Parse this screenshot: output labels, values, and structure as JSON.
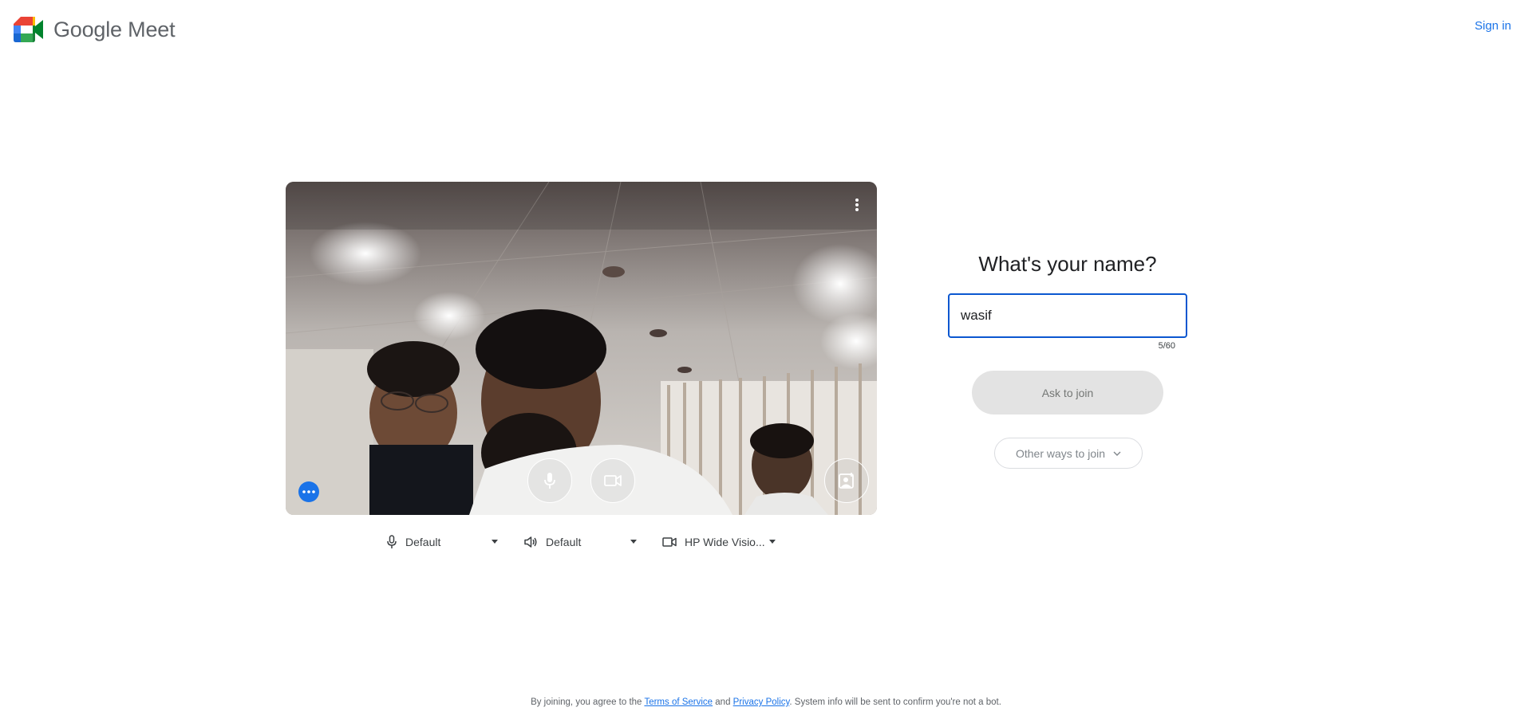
{
  "header": {
    "brand": "Google Meet",
    "sign_in_label": "Sign in"
  },
  "devices": {
    "microphone": "Default",
    "speaker": "Default",
    "camera": "HP Wide Visio..."
  },
  "join": {
    "title": "What's your name?",
    "name_value": "wasif",
    "char_counter": "5/60",
    "ask_button": "Ask to join",
    "other_ways_button": "Other ways to join"
  },
  "footer": {
    "prefix": "By joining, you agree to the",
    "terms_link": "Terms of Service",
    "and_text": "and",
    "privacy_link": "Privacy Policy",
    "suffix": ". System info will be sent to confirm you're not a bot."
  },
  "icons": {
    "logo": "google-meet-logo-icon",
    "more": "more-vert-icon",
    "mic": "microphone-icon",
    "camera": "video-camera-icon",
    "effects": "visual-effects-icon",
    "overflow": "more-horiz-icon",
    "speaker": "speaker-icon",
    "chevron": "chevron-down-icon"
  },
  "colors": {
    "accent": "#1a73e8",
    "focus_border": "#0b57d0",
    "disabled_button": "#e3e3e3"
  }
}
